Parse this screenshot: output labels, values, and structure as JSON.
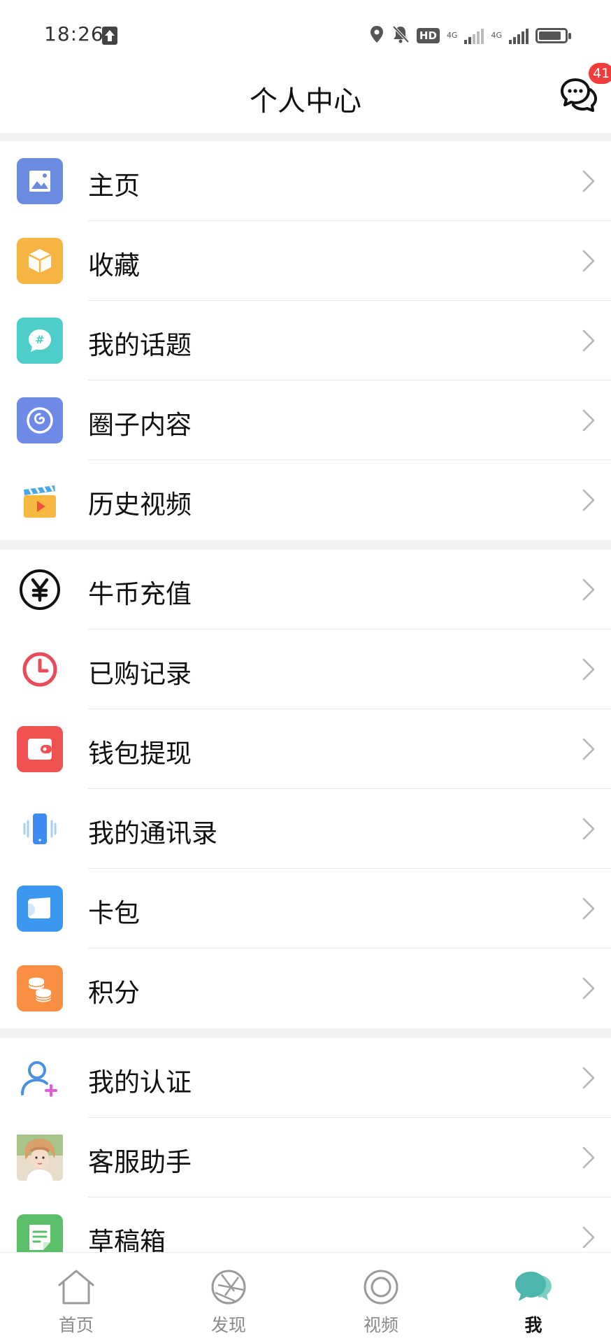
{
  "status_bar": {
    "time": "18:26",
    "icons": [
      "upload-icon",
      "location-icon",
      "mute-icon",
      "hd-icon",
      "signal-icon",
      "signal-icon",
      "battery-icon"
    ],
    "hd_label": "HD",
    "net1": "4G",
    "net2": "4G",
    "battery_level": 0.85
  },
  "header": {
    "title": "个人中心",
    "message_badge": "41",
    "message_icon": "chat-bubbles-icon"
  },
  "sections": [
    {
      "items": [
        {
          "label": "主页",
          "icon": "image-icon",
          "color": "#6B8BE0"
        },
        {
          "label": "收藏",
          "icon": "box-icon",
          "color": "#F6B443"
        },
        {
          "label": "我的话题",
          "icon": "hashtag-chat-icon",
          "color": "#4FCDC9"
        },
        {
          "label": "圈子内容",
          "icon": "circle-swirl-icon",
          "color": "#6E8AE8"
        },
        {
          "label": "历史视频",
          "icon": "clapperboard-icon",
          "color": "#F8B83F"
        }
      ]
    },
    {
      "items": [
        {
          "label": "牛币充值",
          "icon": "yuan-coin-icon",
          "color": "#111111"
        },
        {
          "label": "已购记录",
          "icon": "clock-icon",
          "color": "#E84C5A"
        },
        {
          "label": "钱包提现",
          "icon": "wallet-icon",
          "color": "#F05252"
        },
        {
          "label": "我的通讯录",
          "icon": "phone-vibrate-icon",
          "color": "#3D8BF2"
        },
        {
          "label": "卡包",
          "icon": "card-icon",
          "color": "#3C97F0"
        },
        {
          "label": "积分",
          "icon": "coins-icon",
          "color": "#F98F43"
        }
      ]
    },
    {
      "items": [
        {
          "label": "我的认证",
          "icon": "user-add-icon",
          "color": "#4A90E2"
        },
        {
          "label": "客服助手",
          "icon": "avatar-photo-icon",
          "color": "#D9B99B"
        },
        {
          "label": "草稿箱",
          "icon": "draft-note-icon",
          "color": "#5BBF6A"
        }
      ]
    }
  ],
  "tabbar": {
    "tabs": [
      {
        "label": "首页",
        "icon": "home-icon",
        "active": false
      },
      {
        "label": "发现",
        "icon": "aperture-icon",
        "active": false
      },
      {
        "label": "视频",
        "icon": "video-circle-icon",
        "active": false
      },
      {
        "label": "我",
        "icon": "chat-bubbles-icon",
        "active": true
      }
    ],
    "active_color": "#4DB6AC"
  }
}
